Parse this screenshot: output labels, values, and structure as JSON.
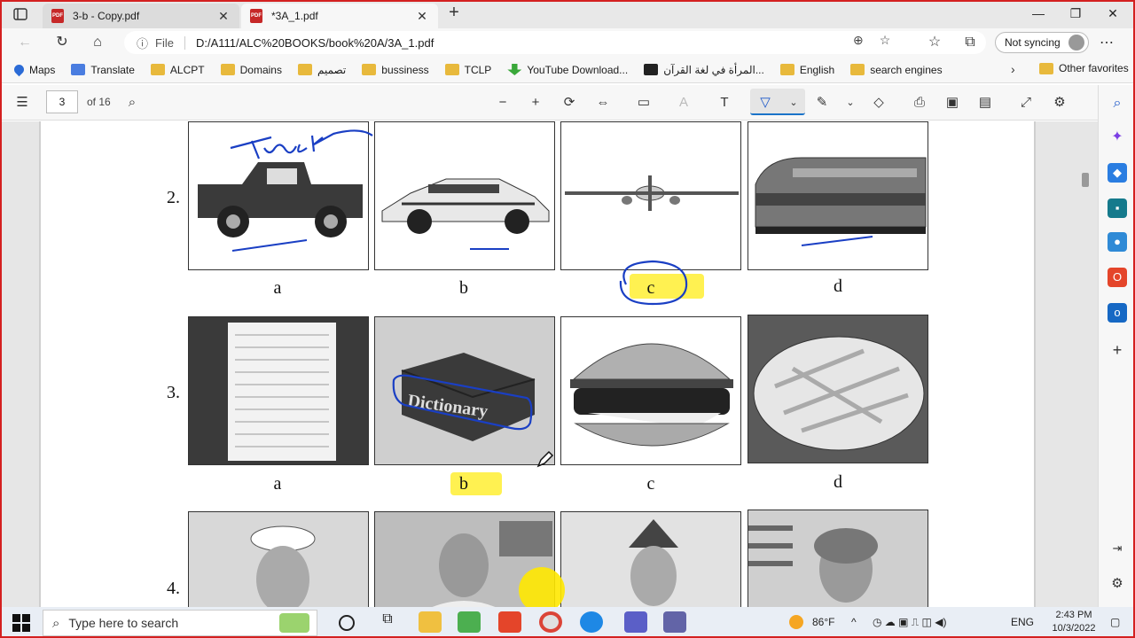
{
  "tabs": [
    {
      "title": "3-b - Copy.pdf",
      "active": false
    },
    {
      "title": "*3A_1.pdf",
      "active": true
    }
  ],
  "address": {
    "info_label": "File",
    "url": "D:/A111/ALC%20BOOKS/book%20A/3A_1.pdf",
    "sync_label": "Not syncing"
  },
  "favorites": [
    {
      "label": "Maps",
      "icon": "maps-pin-icon"
    },
    {
      "label": "Translate",
      "icon": "translate-icon"
    },
    {
      "label": "ALCPT",
      "icon": "folder-icon"
    },
    {
      "label": "Domains",
      "icon": "folder-icon"
    },
    {
      "label": "تصميم",
      "icon": "folder-icon"
    },
    {
      "label": "bussiness",
      "icon": "folder-icon"
    },
    {
      "label": "TCLP",
      "icon": "folder-icon"
    },
    {
      "label": "YouTube Download...",
      "icon": "download-icon"
    },
    {
      "label": "المرأة في لغة القرآن...",
      "icon": "site-icon"
    },
    {
      "label": "English",
      "icon": "folder-icon"
    },
    {
      "label": "search engines",
      "icon": "folder-icon"
    }
  ],
  "other_favorites": "Other favorites",
  "pdf_toolbar": {
    "page_number": "3",
    "page_total": "of 16"
  },
  "document": {
    "questions": [
      {
        "number": "2.",
        "choices": [
          "a",
          "b",
          "c",
          "d"
        ],
        "answer": "c",
        "pictures": [
          "pickup truck",
          "sports car",
          "airplane",
          "locomotive"
        ]
      },
      {
        "number": "3.",
        "choices": [
          "a",
          "b",
          "c",
          "d"
        ],
        "answer": "b",
        "pictures": [
          "calendar page",
          "dictionary book",
          "hamburger",
          "plate of fries"
        ]
      },
      {
        "number": "4.",
        "choices": [],
        "pictures": [
          "sailor",
          "man at desk",
          "woman in cap",
          "woman with flag"
        ]
      }
    ],
    "handwriting": [
      "Truck",
      "Dictionary"
    ]
  },
  "taskbar": {
    "search_placeholder": "Type here to search",
    "temperature": "86°F",
    "language": "ENG",
    "time": "2:43 PM",
    "date": "10/3/2022"
  }
}
